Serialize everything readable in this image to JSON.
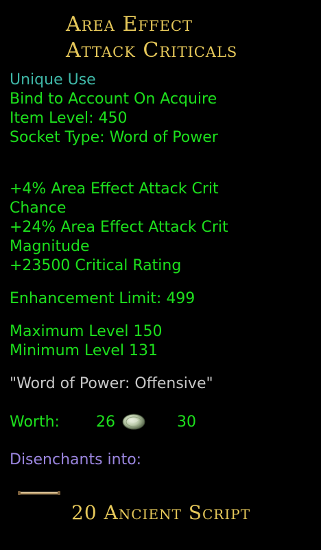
{
  "item": {
    "title_line1": "Area Effect",
    "title_line2": "Attack Criticals",
    "use": "Unique Use",
    "bind": "Bind to Account On Acquire",
    "item_level": "Item Level: 450",
    "socket_type": "Socket Type: Word of Power",
    "stats": {
      "line1": "+4% Area Effect Attack Crit",
      "line2": "Chance",
      "line3": "+24% Area Effect Attack Crit",
      "line4": "Magnitude",
      "line5": "+23500 Critical Rating"
    },
    "enhancement_limit": "Enhancement Limit: 499",
    "max_level": "Maximum Level 150",
    "min_level": "Minimum Level 131",
    "flavor": "\"Word of Power: Offensive\"",
    "worth": {
      "label": "Worth:",
      "gold": "26",
      "silver": "30"
    },
    "disenchant_label": "Disenchants into:",
    "disenchant_result": "20 Ancient Script"
  },
  "colors": {
    "title": "#e6c85a",
    "cyan": "#3fb8a8",
    "green": "#1de01d",
    "gray": "#c8c8c8",
    "purple": "#9b86e0"
  },
  "icons": {
    "coin": "silver-coin-icon",
    "scroll": "ancient-script-icon"
  }
}
